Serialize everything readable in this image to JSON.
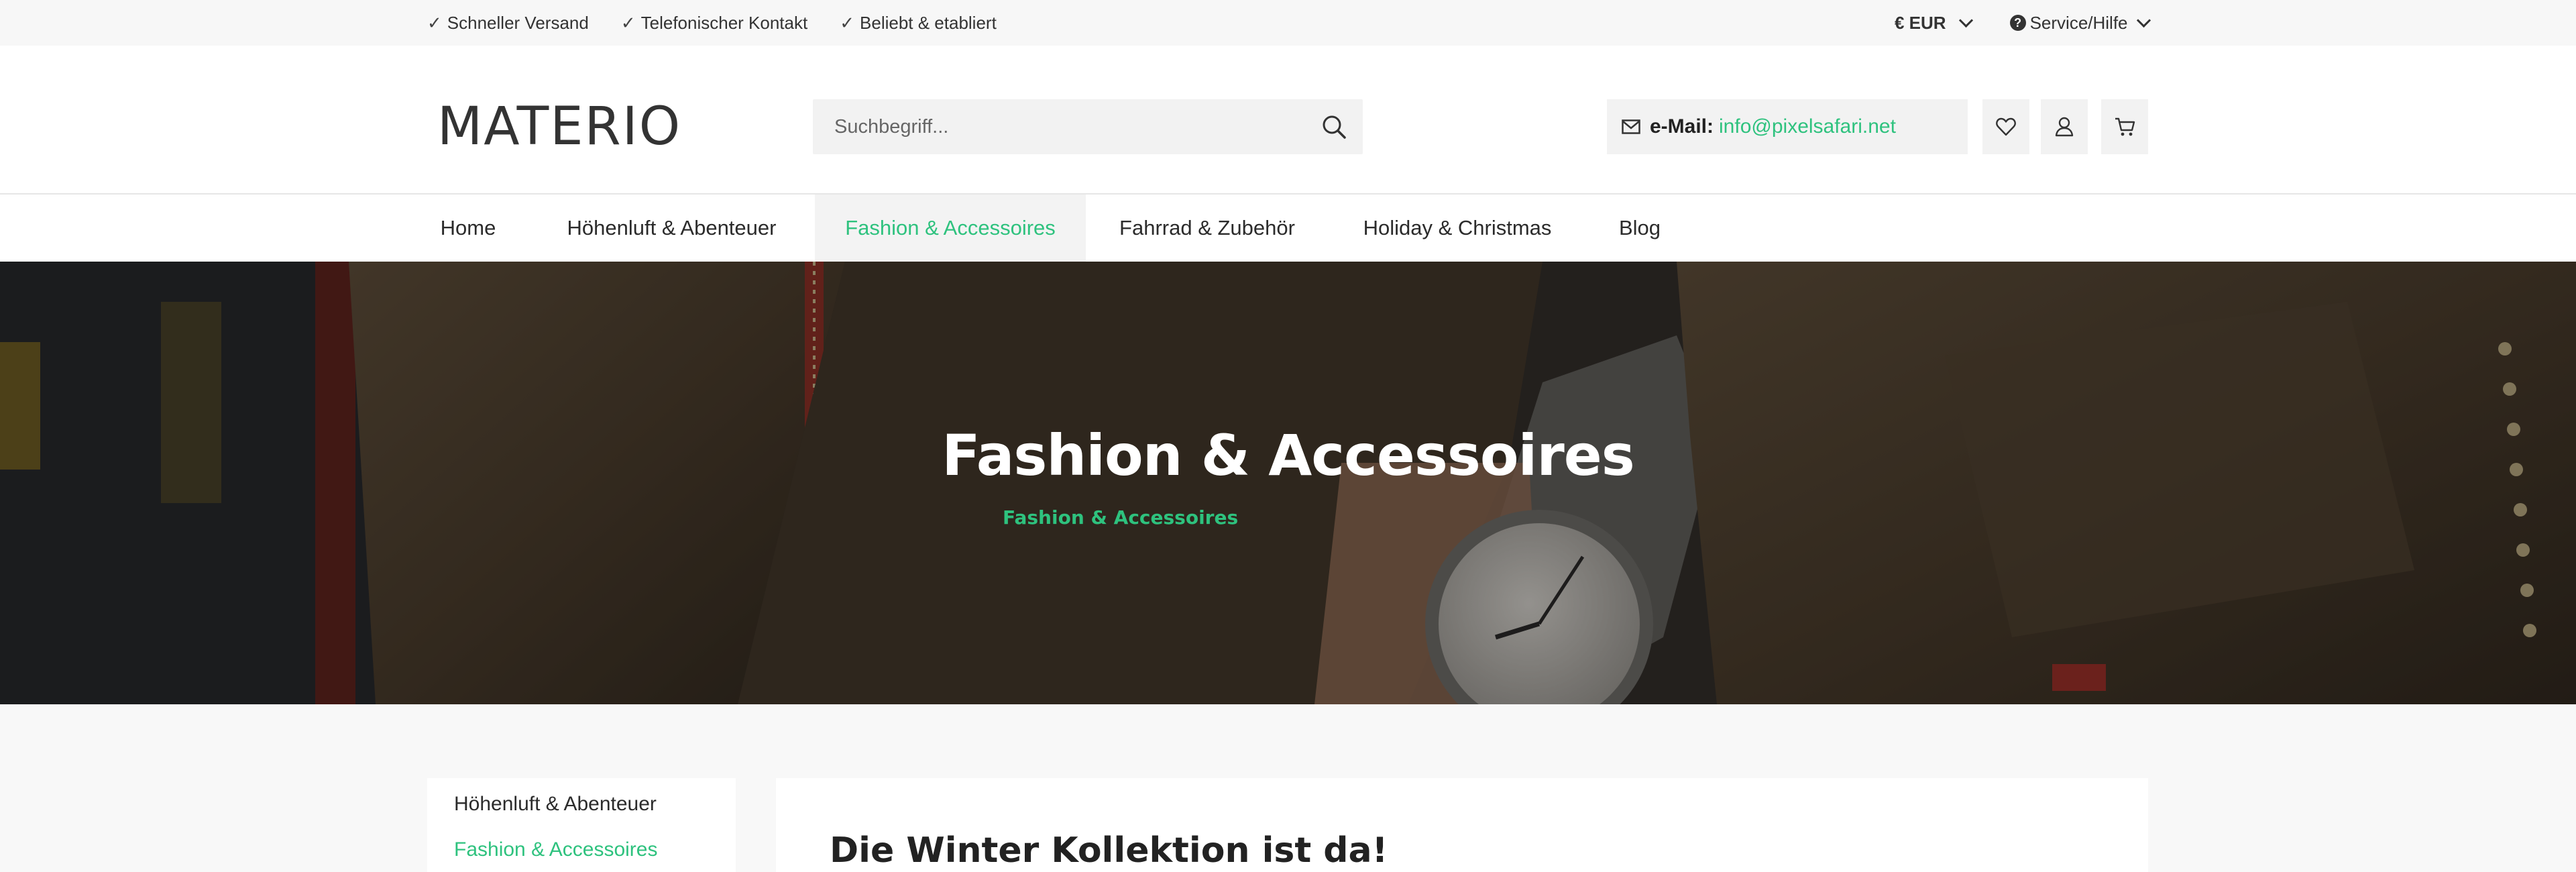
{
  "topbar": {
    "usps": [
      {
        "check": "✓",
        "label": "Schneller Versand"
      },
      {
        "check": "✓",
        "label": "Telefonischer Kontakt"
      },
      {
        "check": "✓",
        "label": "Beliebt & etabliert"
      }
    ],
    "currency": "€ EUR",
    "service_label": "Service/Hilfe",
    "service_icon": "?"
  },
  "header": {
    "logo": "MATERIO",
    "search_placeholder": "Suchbegriff...",
    "email_label": "e-Mail:",
    "email_address": "info@pixelsafari.net"
  },
  "nav": {
    "items": [
      {
        "label": "Home"
      },
      {
        "label": "Höhenluft & Abenteuer"
      },
      {
        "label": "Fashion & Accessoires",
        "active": true
      },
      {
        "label": "Fahrrad & Zubehör"
      },
      {
        "label": "Holiday & Christmas"
      },
      {
        "label": "Blog"
      }
    ]
  },
  "hero": {
    "title": "Fashion & Accessoires",
    "breadcrumb": "Fashion & Accessoires"
  },
  "sidebar": {
    "items": [
      {
        "label": "Höhenluft & Abenteuer"
      },
      {
        "label": "Fashion & Accessoires",
        "active": true
      }
    ]
  },
  "content": {
    "heading": "Die Winter Kollektion ist da!"
  },
  "colors": {
    "accent": "#2ec27e",
    "text": "#2b2b2b",
    "panel": "#f2f2f2"
  },
  "icons": {
    "search": "search-icon",
    "email": "envelope-icon",
    "wishlist": "heart-icon",
    "account": "user-icon",
    "cart": "cart-icon"
  }
}
